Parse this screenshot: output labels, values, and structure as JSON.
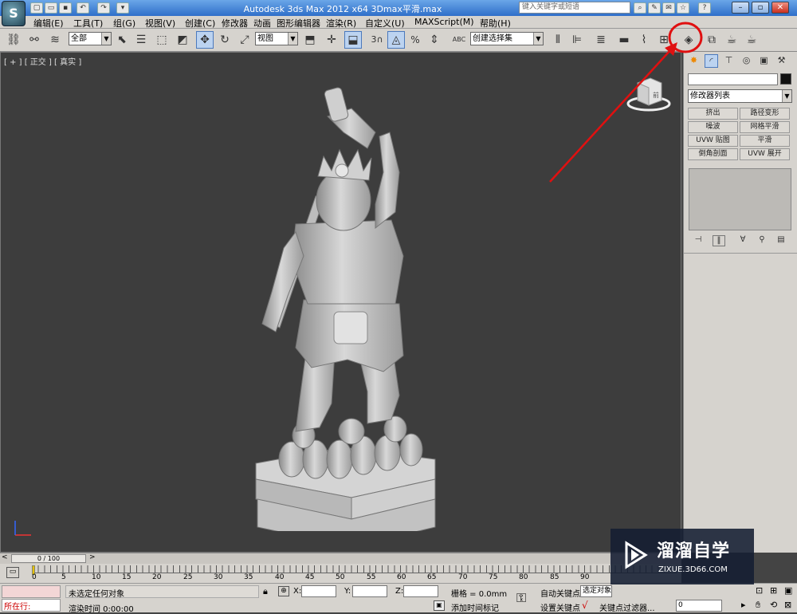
{
  "title_bar": {
    "title": "Autodesk 3ds Max  2012 x64   3Dmax平滑.max",
    "search_placeholder": "键入关键字或短语"
  },
  "menu": [
    "编辑(E)",
    "工具(T)",
    "组(G)",
    "视图(V)",
    "创建(C)",
    "修改器",
    "动画",
    "图形编辑器",
    "渲染(R)",
    "自定义(U)",
    "MAXScript(M)",
    "帮助(H)"
  ],
  "toolbar": {
    "filter_dropdown": "全部",
    "refcoord_dropdown": "视图",
    "snap_label": "3",
    "percent_label": "%",
    "selection_set": "创建选择集",
    "abc_label": "ABC"
  },
  "viewport": {
    "label": "[ + ] [ 正交 ] [ 真实 ]",
    "cube_label": "前"
  },
  "command_panel": {
    "modifier_list": "修改器列表",
    "buttons": [
      "挤出",
      "路径变形",
      "噪波",
      "网格平滑",
      "UVW 贴图",
      "平滑",
      "倒角剖面",
      "UVW 展开"
    ]
  },
  "time_slider": {
    "frame": "0 / 100"
  },
  "trackbar": {
    "ticks": [
      "0",
      "5",
      "10",
      "15",
      "20",
      "25",
      "30",
      "35",
      "40",
      "45",
      "50",
      "55",
      "60",
      "65",
      "70",
      "75",
      "80",
      "85",
      "90"
    ]
  },
  "status": {
    "maxscript_label": "所在行:",
    "message": "未选定任何对象",
    "render_time": "渲染时间 0:00:00",
    "x_label": "X:",
    "y_label": "Y:",
    "z_label": "Z:",
    "grid": "栅格 = 0.0mm",
    "add_time_tag": "添加时间标记",
    "auto_key": "自动关键点",
    "selected_object": "选定对象",
    "set_key": "设置关键点",
    "key_filters": "关键点过滤器...",
    "frame_field": "0"
  },
  "watermark": {
    "title": "溜溜自学",
    "subtitle": "ZIXUE.3D66.COM"
  },
  "colors": {
    "annotation": "#e01010",
    "titlebar": "#2f6fc9",
    "viewport": "#3d3d3d"
  }
}
